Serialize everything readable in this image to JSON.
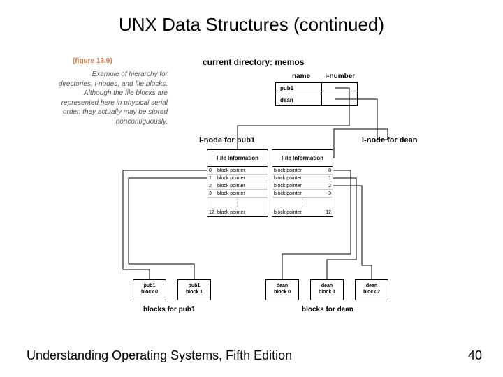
{
  "title": "UNX Data Structures (continued)",
  "figure_label": "(figure 13.9)",
  "caption": "Example of hierarchy for directories, i-nodes, and file blocks. Although the file blocks are represented here in physical serial order, they actually may be stored noncontiguously.",
  "current_dir_label": "current directory: memos",
  "dir_cols": {
    "name": "name",
    "inum": "i-number"
  },
  "dir_rows": [
    {
      "name": "pub1",
      "inum": ""
    },
    {
      "name": "dean",
      "inum": ""
    }
  ],
  "inode_labels": {
    "left": "i-node for pub1",
    "right": "i-node for dean"
  },
  "inode_header": "File Information",
  "inode_left_rows": [
    {
      "n": "0",
      "t": "block pointer"
    },
    {
      "n": "1",
      "t": "block pointer"
    },
    {
      "n": "2",
      "t": "block pointer"
    },
    {
      "n": "3",
      "t": "block pointer"
    }
  ],
  "inode_left_last": {
    "n": "12",
    "t": "block pointer"
  },
  "inode_right_rows": [
    {
      "t": "block pointer",
      "n": "0"
    },
    {
      "t": "block pointer",
      "n": "1"
    },
    {
      "t": "block pointer",
      "n": "2"
    },
    {
      "t": "block pointer",
      "n": "3"
    }
  ],
  "inode_right_last": {
    "t": "block pointer",
    "n": "12"
  },
  "fblocks": [
    {
      "name": "pub1",
      "blk": "block 0"
    },
    {
      "name": "pub1",
      "blk": "block 1"
    },
    {
      "name": "dean",
      "blk": "block 0"
    },
    {
      "name": "dean",
      "blk": "block 1"
    },
    {
      "name": "dean",
      "blk": "block 2"
    }
  ],
  "blocks_label_left": "blocks for pub1",
  "blocks_label_right": "blocks for dean",
  "footer_text": "Understanding Operating Systems, Fifth Edition",
  "footer_page": "40"
}
